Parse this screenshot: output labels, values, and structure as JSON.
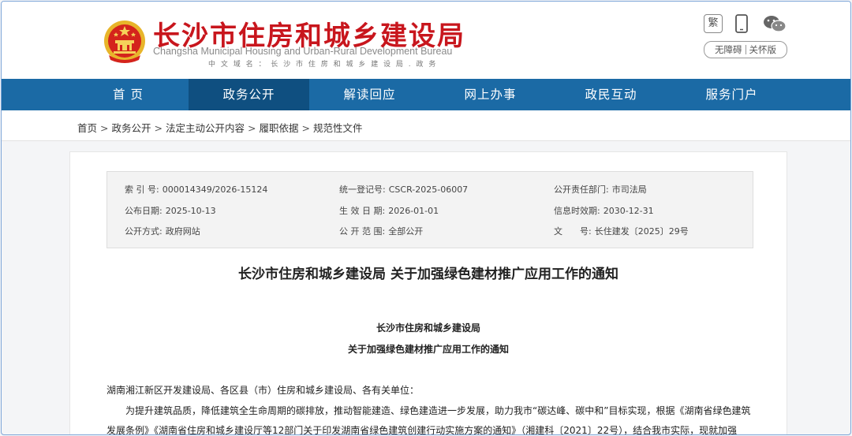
{
  "header": {
    "title_cn": "长沙市住房和城乡建设局",
    "title_en": "Changsha Municipal Housing and Urban-Rural Development Bureau",
    "domain_line": "中 文 域 名 ： 长 沙 市 住 房 和 城 乡 建 设 局 . 政 务",
    "fan_label": "繁",
    "accessibility": "无障碍",
    "elderly": "关怀版"
  },
  "nav": {
    "items": [
      {
        "label": "首  页"
      },
      {
        "label": "政务公开"
      },
      {
        "label": "解读回应"
      },
      {
        "label": "网上办事"
      },
      {
        "label": "政民互动"
      },
      {
        "label": "服务门户"
      }
    ],
    "active_index": 1
  },
  "breadcrumb": [
    "首页",
    "政务公开",
    "法定主动公开内容",
    "履职依据",
    "规范性文件"
  ],
  "breadcrumb_sep": ">",
  "meta": {
    "index_label": "索 引 号:",
    "index_value": "000014349/2026-15124",
    "reg_label": "统一登记号:",
    "reg_value": "CSCR-2025-06007",
    "dept_label": "公开责任部门:",
    "dept_value": "市司法局",
    "pub_label": "公布日期:",
    "pub_value": "2025-10-13",
    "eff_label": "生 效 日 期:",
    "eff_value": "2026-01-01",
    "exp_label": "信息时效期:",
    "exp_value": "2030-12-31",
    "way_label": "公开方式:",
    "way_value": "政府网站",
    "scope_label": "公 开 范 围:",
    "scope_value": "全部公开",
    "doc_label": "文　　号:",
    "doc_value": "长住建发〔2025〕29号"
  },
  "article": {
    "title": "长沙市住房和城乡建设局 关于加强绿色建材推广应用工作的通知",
    "sub1": "长沙市住房和城乡建设局",
    "sub2": "关于加强绿色建材推广应用工作的通知",
    "addressee": "湖南湘江新区开发建设局、各区县（市）住房和城乡建设局、各有关单位：",
    "body": "为提升建筑品质，降低建筑全生命周期的碳排放，推动智能建造、绿色建造进一步发展，助力我市“碳达峰、碳中和”目标实现，根据《湖南省绿色建筑发展条例》《湖南省住房和城乡建设厅等12部门关于印发湖南省绿色建筑创建行动实施方案的通知》（湘建科〔2021〕22号），结合我市实际，现就加强"
  },
  "colors": {
    "brand_red": "#c8161d",
    "nav_blue": "#1b6aa5",
    "nav_active": "#0f4f80"
  },
  "icons": [
    "national-emblem-icon",
    "phone-icon",
    "wechat-icon"
  ]
}
